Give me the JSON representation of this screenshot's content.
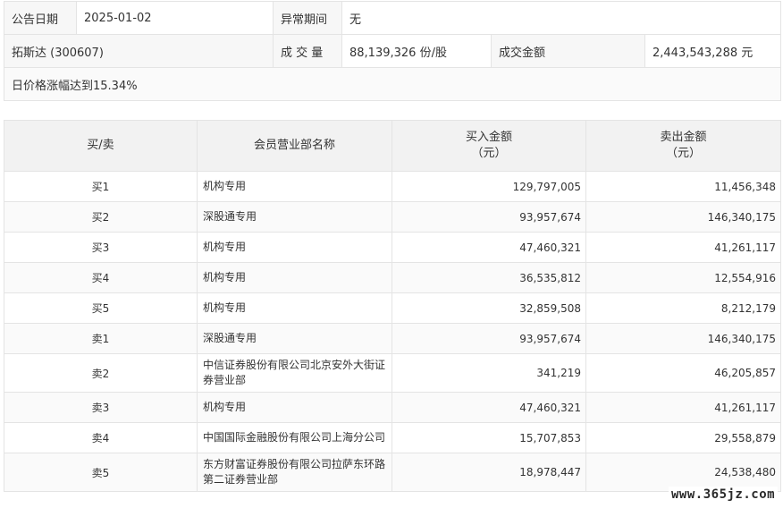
{
  "notice": {
    "date_label": "公告日期",
    "date_value": "2025-01-02",
    "period_label": "异常期间",
    "period_value": "无",
    "stock_name": "拓斯达 (300607)",
    "volume_label": "成 交 量",
    "volume_value": "88,139,326 份/股",
    "amount_label": "成交金额",
    "amount_value": "2,443,543,288 元",
    "reason": "日价格涨幅达到15.34%"
  },
  "table": {
    "headers": {
      "side": "买/卖",
      "member": "会员营业部名称",
      "buy_amount_line1": "买入金额",
      "buy_amount_line2": "（元）",
      "sell_amount_line1": "卖出金额",
      "sell_amount_line2": "（元）"
    },
    "rows": [
      {
        "side": "买1",
        "member": "机构专用",
        "buy": "129,797,005",
        "sell": "11,456,348"
      },
      {
        "side": "买2",
        "member": "深股通专用",
        "buy": "93,957,674",
        "sell": "146,340,175"
      },
      {
        "side": "买3",
        "member": "机构专用",
        "buy": "47,460,321",
        "sell": "41,261,117"
      },
      {
        "side": "买4",
        "member": "机构专用",
        "buy": "36,535,812",
        "sell": "12,554,916"
      },
      {
        "side": "买5",
        "member": "机构专用",
        "buy": "32,859,508",
        "sell": "8,212,179"
      },
      {
        "side": "卖1",
        "member": "深股通专用",
        "buy": "93,957,674",
        "sell": "146,340,175"
      },
      {
        "side": "卖2",
        "member": "中信证券股份有限公司北京安外大街证券营业部",
        "buy": "341,219",
        "sell": "46,205,857"
      },
      {
        "side": "卖3",
        "member": "机构专用",
        "buy": "47,460,321",
        "sell": "41,261,117"
      },
      {
        "side": "卖4",
        "member": "中国国际金融股份有限公司上海分公司",
        "buy": "15,707,853",
        "sell": "29,558,879"
      },
      {
        "side": "卖5",
        "member": "东方财富证券股份有限公司拉萨东环路第二证券营业部",
        "buy": "18,978,447",
        "sell": "24,538,480"
      }
    ]
  },
  "watermark": "www.365jz.com"
}
